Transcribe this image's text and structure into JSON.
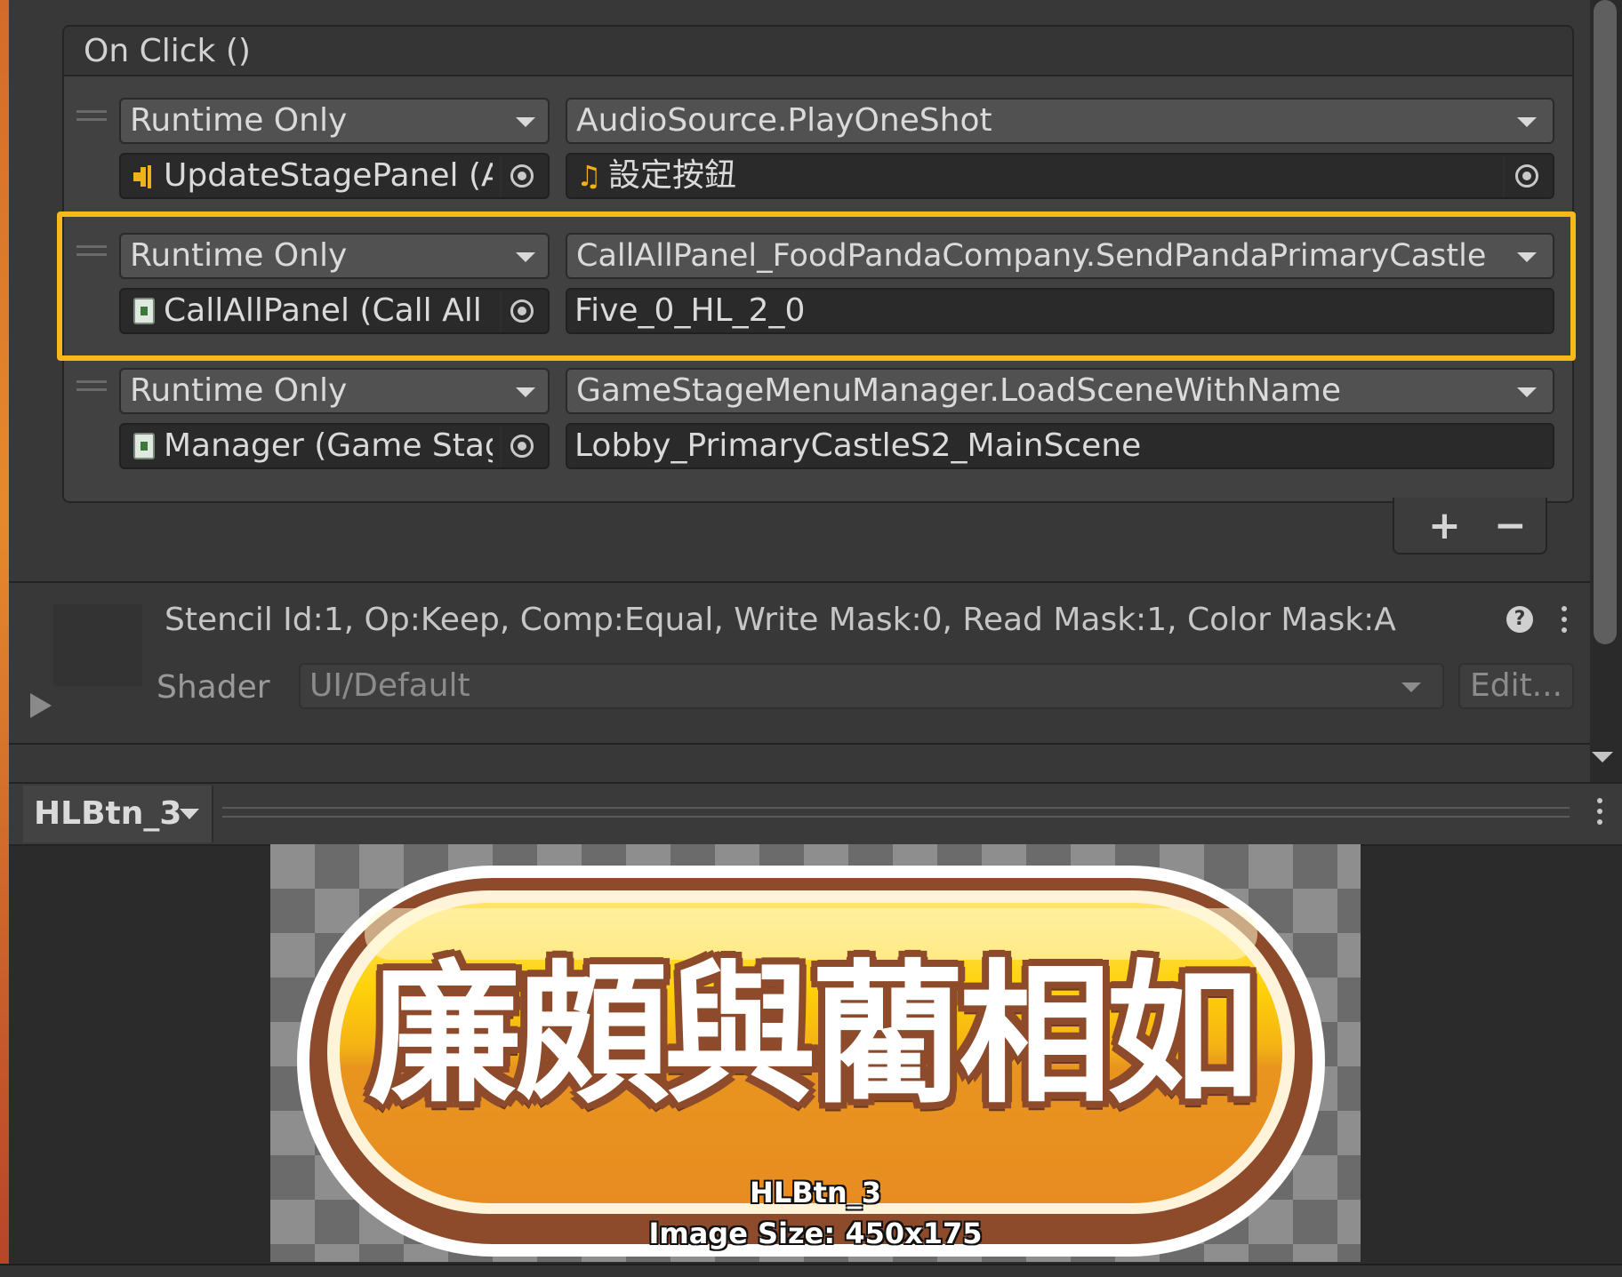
{
  "event": {
    "title": "On Click ()",
    "rows": [
      {
        "call_mode": "Runtime Only",
        "function": "AudioSource.PlayOneShot",
        "target_object": "UpdateStagePanel (A",
        "target_icon": "audio-source-icon",
        "argument": "設定按鈕",
        "argument_icon": "audio-clip-icon",
        "highlighted": false
      },
      {
        "call_mode": "Runtime Only",
        "function": "CallAllPanel_FoodPandaCompany.SendPandaPrimaryCastle",
        "target_object": "CallAllPanel (Call All F",
        "target_icon": "script-icon",
        "argument": "Five_0_HL_2_0",
        "highlighted": true,
        "highlight_color": "#f5b91a"
      },
      {
        "call_mode": "Runtime Only",
        "function": "GameStageMenuManager.LoadSceneWithName",
        "target_object": "Manager (Game Stage",
        "target_icon": "script-icon",
        "argument": "Lobby_PrimaryCastleS2_MainScene",
        "highlighted": false
      }
    ],
    "add_label": "+",
    "remove_label": "−"
  },
  "material": {
    "stencil_info": "Stencil Id:1, Op:Keep, Comp:Equal, Write Mask:0, Read Mask:1, Color Mask:A",
    "shader_label": "Shader",
    "shader_value": "UI/Default",
    "edit_label": "Edit..."
  },
  "preview": {
    "name": "HLBtn_3",
    "button_text": "廉頗與藺相如",
    "asset_label": "HLBtn_3",
    "image_size": "Image Size: 450x175"
  },
  "colors": {
    "panel_bg": "#383838",
    "highlight": "#f5b91a",
    "button_gold": "#ffd20a",
    "button_brown": "#8e4b2b"
  }
}
